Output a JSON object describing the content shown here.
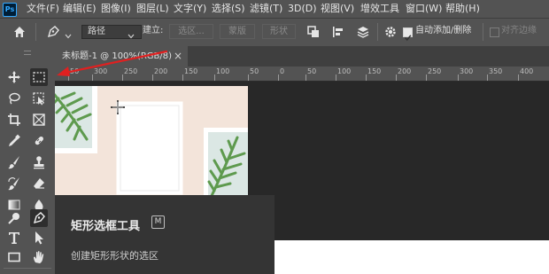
{
  "app": {
    "logo": "Ps"
  },
  "menu": [
    "文件(F)",
    "编辑(E)",
    "图像(I)",
    "图层(L)",
    "文字(Y)",
    "选择(S)",
    "滤镜(T)",
    "3D(D)",
    "视图(V)",
    "增效工具",
    "窗口(W)",
    "帮助(H)"
  ],
  "options": {
    "path_mode": "路径",
    "make_label": "建立:",
    "selection_btn": "选区...",
    "mask_btn": "蒙版",
    "shape_btn": "形状",
    "auto_add_delete_label": "自动添加/删除",
    "auto_add_delete_checked": true,
    "align_edges_label": "对齐边缘",
    "align_edges_checked": false
  },
  "document": {
    "tab_title": "未标题-1 @ 100%(RGB/8)",
    "close_glyph": "×",
    "ruler_numbers": [
      "50",
      "300",
      "250",
      "200",
      "150",
      "100",
      "50",
      "0",
      "50",
      "100",
      "150",
      "200",
      "250",
      "300",
      "350",
      "400"
    ]
  },
  "tooltip": {
    "title": "矩形选框工具",
    "shortcut": "M",
    "description": "创建矩形形状的选区"
  },
  "colors": {
    "annotation_arrow": "#e02020",
    "panel_bg": "#535353",
    "workspace_bg": "#282828",
    "canvas_bg": "#f3e4da",
    "leaf_green": "#5e9a4e"
  },
  "icons": {
    "home": "home-icon",
    "pen": "pen-tool-icon",
    "marquee": "rectangular-marquee-icon",
    "gear": "gear-icon"
  }
}
